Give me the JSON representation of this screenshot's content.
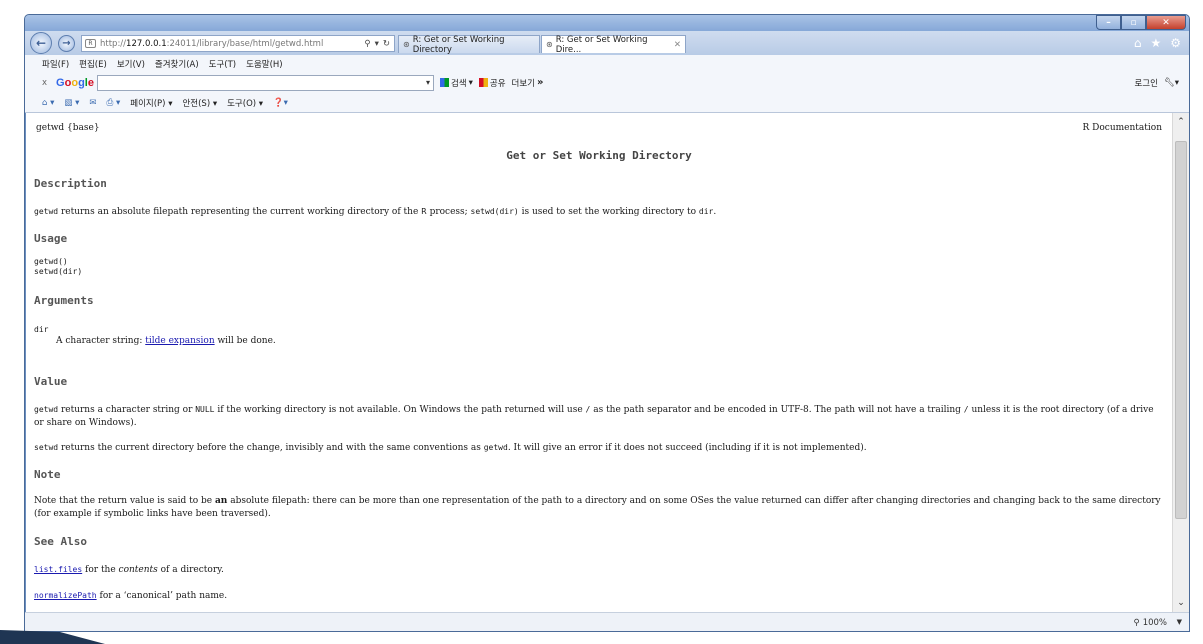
{
  "browser": {
    "url_prefix": "http://",
    "url_host": "127.0.0.1",
    "url_rest": ":24011/library/base/html/getwd.html",
    "tabs": [
      {
        "label": "R: Get or Set Working Directory"
      },
      {
        "label": "R: Get or Set Working Dire..."
      }
    ],
    "menu": [
      "파일(F)",
      "편집(E)",
      "보기(V)",
      "즐겨찾기(A)",
      "도구(T)",
      "도움말(H)"
    ],
    "google": {
      "close": "x",
      "logo": "Google",
      "search_btn": "검색",
      "share_btn": "공유",
      "more_btn": "더보기",
      "more_chev": "»",
      "login": "로그인"
    },
    "commands": {
      "page": "페이지(P)",
      "safety": "안전(S)",
      "tools": "도구(O)"
    },
    "zoom": "100%"
  },
  "doc": {
    "header_left": "getwd {base}",
    "header_right": "R Documentation",
    "title": "Get or Set Working Directory",
    "description": {
      "heading": "Description",
      "code1": "getwd",
      "text1": " returns an absolute filepath representing the current working directory of the ",
      "r": "R",
      "text2": " process; ",
      "code2": "setwd(dir)",
      "text3": " is used to set the working directory to ",
      "code3": "dir",
      "text4": "."
    },
    "usage": {
      "heading": "Usage",
      "line1": "getwd()",
      "line2": "setwd(dir)"
    },
    "arguments": {
      "heading": "Arguments",
      "name": "dir",
      "text1": "A character string: ",
      "link": "tilde expansion",
      "text2": " will be done."
    },
    "value": {
      "heading": "Value",
      "p1_code1": "getwd",
      "p1_text1": " returns a character string or ",
      "p1_code2": "NULL",
      "p1_text2": " if the working directory is not available. On Windows the path returned will use ",
      "p1_code3": "/",
      "p1_text3": " as the path separator and be encoded in UTF-8. The path will not have a trailing ",
      "p1_code4": "/",
      "p1_text4": " unless it is the root directory (of a drive or share on Windows).",
      "p2_code1": "setwd",
      "p2_text1": " returns the current directory before the change, invisibly and with the same conventions as ",
      "p2_code2": "getwd",
      "p2_text2": ". It will give an error if it does not succeed (including if it is not implemented)."
    },
    "note": {
      "heading": "Note",
      "text1": "Note that the return value is said to be ",
      "bold": "an",
      "text2": " absolute filepath: there can be more than one representation of the path to a directory and on some OSes the value returned can differ after changing directories and changing back to the same directory (for example if symbolic links have been traversed)."
    },
    "see_also": {
      "heading": "See Also",
      "link1": "list.files",
      "text1a": " for the ",
      "italic": "contents",
      "text1b": " of a directory.",
      "link2": "normalizePath",
      "text2": " for a ‘canonical’ path name."
    }
  }
}
